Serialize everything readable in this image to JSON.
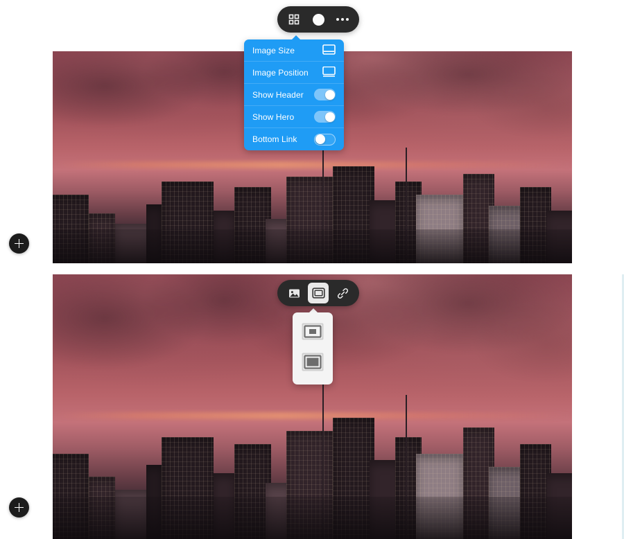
{
  "page": {
    "title": "Page Builder Canvas",
    "background_color": "#ffffff"
  },
  "colors": {
    "menu_blue": "#1f9cf5",
    "menu_blue_toggle_track": "#7ec5fa",
    "toolbar_dark": "#2a2a2a",
    "popover_white": "#f4f4f4",
    "add_button_dark": "#1c1c1c",
    "right_rail": "#dfeef2"
  },
  "top_section": {
    "toolbar": {
      "name": "section-toolbar",
      "items": [
        {
          "icon": "grid-icon",
          "label": "Layout Options",
          "selected": false
        },
        {
          "icon": "circle-icon",
          "label": "Color",
          "selected": false
        },
        {
          "icon": "more-icon",
          "label": "More Options",
          "selected": false
        }
      ]
    },
    "settings_menu": {
      "rows": [
        {
          "label": "Image Size",
          "control": "chooser",
          "icon": "image-size-icon"
        },
        {
          "label": "Image Position",
          "control": "chooser",
          "icon": "image-position-icon"
        },
        {
          "label": "Show Header",
          "control": "toggle",
          "state": "on"
        },
        {
          "label": "Show Hero",
          "control": "toggle",
          "state": "on"
        },
        {
          "label": "Bottom Link",
          "control": "toggle",
          "state": "off"
        }
      ]
    },
    "hero_image": {
      "alt": "City skyline at dusk with pink and maroon sky"
    },
    "add_button": {
      "label": "+",
      "name": "add-section-button"
    }
  },
  "bottom_section": {
    "toolbar": {
      "name": "image-toolbar",
      "items": [
        {
          "icon": "picture-icon",
          "label": "Replace Image",
          "selected": false
        },
        {
          "icon": "image-size-icon",
          "label": "Image Size",
          "selected": true
        },
        {
          "icon": "link-icon",
          "label": "Add Link",
          "selected": false
        }
      ]
    },
    "size_popover": {
      "options": [
        {
          "icon": "size-small-icon",
          "label": "Small Image",
          "selected": false
        },
        {
          "icon": "size-large-icon",
          "label": "Large Image",
          "selected": false
        }
      ]
    },
    "hero_image": {
      "alt": "City skyline at dusk with pink and maroon sky"
    },
    "add_button": {
      "label": "+",
      "name": "add-section-button"
    }
  }
}
